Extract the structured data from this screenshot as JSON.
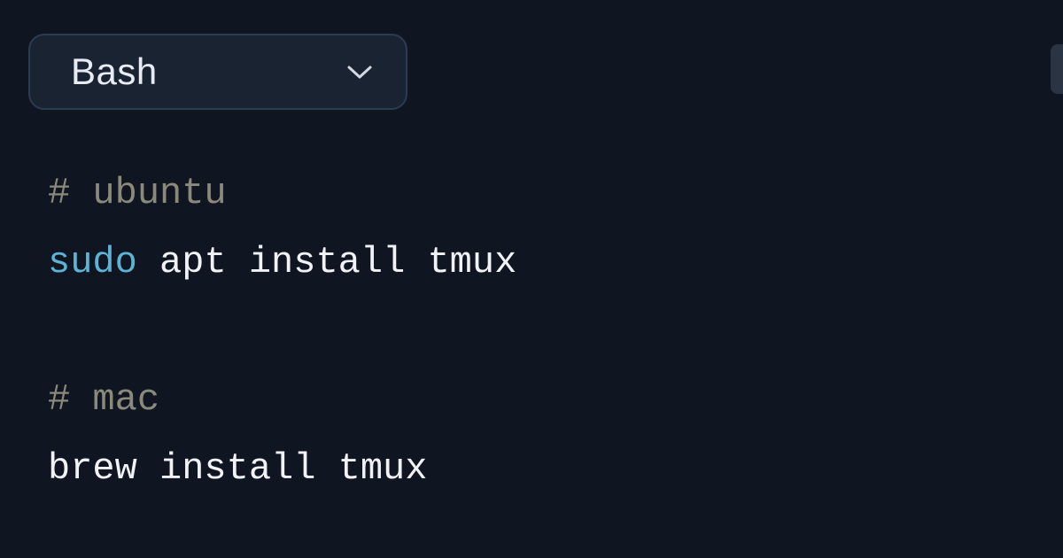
{
  "selector": {
    "label": "Bash"
  },
  "code": {
    "line1_comment": "# ubuntu",
    "line2_keyword": "sudo",
    "line2_rest": " apt install tmux",
    "line3_comment": "# mac",
    "line4_plain": "brew install tmux"
  }
}
